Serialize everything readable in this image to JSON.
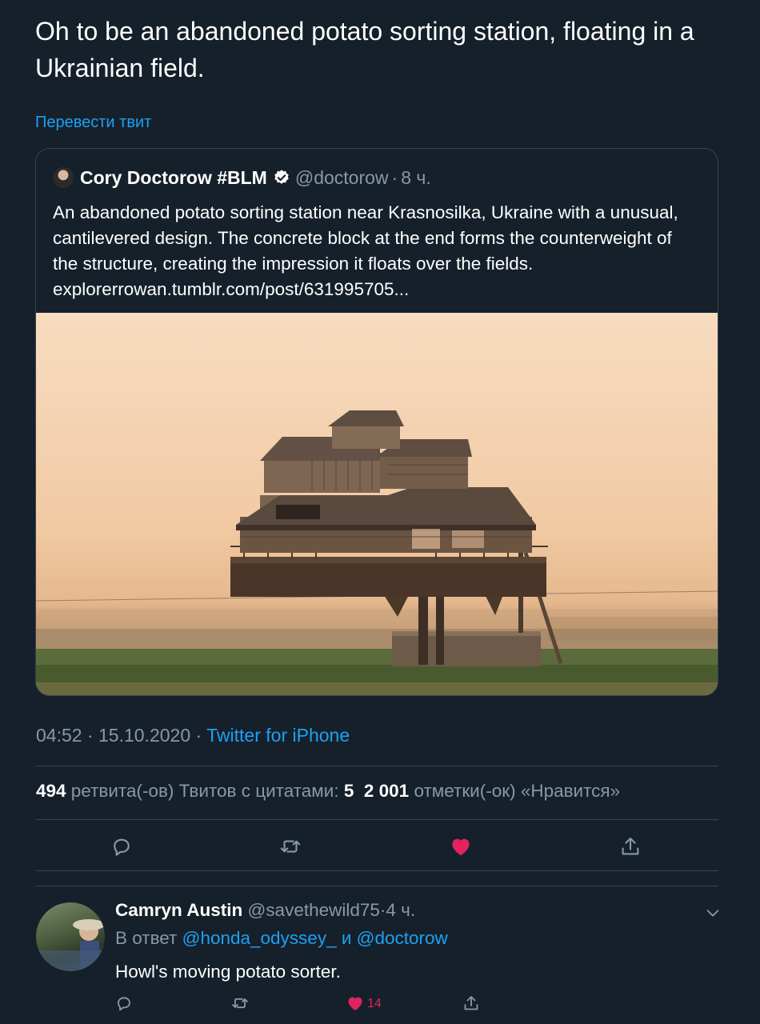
{
  "tweet": {
    "text": "Oh to be an abandoned potato sorting station, floating in a Ukrainian field.",
    "translate_label": "Перевести твит",
    "timestamp": "04:52 · 15.10.2020 · ",
    "source": "Twitter for iPhone"
  },
  "quoted": {
    "name": "Cory Doctorow #BLM",
    "handle": "@doctorow",
    "separator": "·",
    "time": "8 ч.",
    "text": "An abandoned potato sorting station near Krasnosilka, Ukraine with a unusual, cantilevered design. The concrete block at the end forms the counterweight of the structure, creating the impression it floats over the fields. explorerrowan.tumblr.com/post/631995705..."
  },
  "stats": {
    "retweets_count": "494",
    "retweets_label": " ретвита(-ов)   Твитов с цитатами: ",
    "quotes_count": "5",
    "likes_count": "2 001",
    "likes_label": " отметки(-ок) «Нравится»"
  },
  "actions": {
    "reply_icon": "reply-icon",
    "retweet_icon": "retweet-icon",
    "like_icon": "heart-filled-icon",
    "like_color": "#e0245e",
    "share_icon": "share-icon",
    "icon_color": "#8899a6"
  },
  "reply": {
    "name": "Camryn Austin",
    "handle": "@savethewild75",
    "separator": "·",
    "time": "4 ч.",
    "reply_prefix": "В ответ ",
    "mention1": "@honda_odyssey_",
    "conjunction": " и ",
    "mention2": "@doctorow",
    "text": "Howl's moving potato sorter.",
    "like_count": "14"
  },
  "colors": {
    "background": "#15202b",
    "accent": "#1da1f2",
    "secondary_text": "#8899a6",
    "border": "#38444d"
  }
}
